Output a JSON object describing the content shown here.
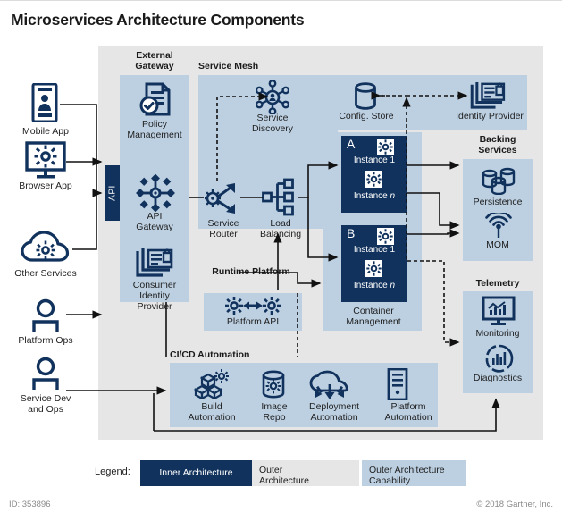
{
  "page": {
    "title": "Microservices Architecture Components",
    "id_text": "ID: 353896",
    "copyright": "© 2018 Gartner, Inc."
  },
  "colors": {
    "inner_architecture": "#11325c",
    "outer_architecture": "#e6e6e6",
    "outer_architecture_capability": "#bdd0e2",
    "icon_navy": "#11325c",
    "page_background": "#ffffff"
  },
  "actors": [
    {
      "id": "mobile-app",
      "label": "Mobile App",
      "icon": "smartphone-person-icon"
    },
    {
      "id": "browser-app",
      "label": "Browser App",
      "icon": "monitor-gear-icon"
    },
    {
      "id": "other-services",
      "label": "Other Services",
      "icon": "cloud-gear-icon"
    },
    {
      "id": "platform-ops",
      "label": "Platform Ops",
      "icon": "person-icon"
    },
    {
      "id": "service-dev-ops",
      "label": "Service Dev\nand Ops",
      "icon": "person-icon"
    }
  ],
  "api_bar": {
    "label": "API"
  },
  "groups": {
    "external_gateway": {
      "title": "External\nGateway",
      "items": [
        {
          "label": "Policy\nManagement",
          "icon": "policy-document-check-icon"
        },
        {
          "label": "API\nGateway",
          "icon": "api-gateway-hub-icon"
        },
        {
          "label": "Consumer\nIdentity\nProvider",
          "icon": "identity-lock-icon"
        }
      ]
    },
    "service_mesh": {
      "title": "Service Mesh",
      "items": [
        {
          "label": "Service\nDiscovery",
          "icon": "service-discovery-icon"
        },
        {
          "label": "Config. Store",
          "icon": "database-cylinder-icon"
        },
        {
          "label": "Identity Provider",
          "icon": "identity-lock-icon"
        },
        {
          "label": "Service\nRouter",
          "icon": "service-router-icon"
        },
        {
          "label": "Load\nBalancing",
          "icon": "load-balancer-icon"
        }
      ]
    },
    "runtime_platform": {
      "title": "Runtime\nPlatform",
      "items": [
        {
          "label": "Platform API",
          "icon": "platform-api-gears-icon"
        }
      ]
    },
    "container_management": {
      "title": "Container\nManagement",
      "services": [
        {
          "letter": "A",
          "instances": [
            {
              "name": "Instance 1",
              "icon": "gear-icon"
            },
            {
              "name": "Instance n",
              "icon": "gear-icon",
              "italic_suffix": "n"
            }
          ]
        },
        {
          "letter": "B",
          "instances": [
            {
              "name": "Instance 1",
              "icon": "gear-icon"
            },
            {
              "name": "Instance n",
              "icon": "gear-icon",
              "italic_suffix": "n"
            }
          ]
        }
      ]
    },
    "backing_services": {
      "title": "Backing\nServices",
      "items": [
        {
          "label": "Persistence",
          "icon": "database-stack-icon"
        },
        {
          "label": "MOM",
          "icon": "broadcast-antenna-icon"
        }
      ]
    },
    "telemetry": {
      "title": "Telemetry",
      "items": [
        {
          "label": "Monitoring",
          "icon": "monitor-chart-icon"
        },
        {
          "label": "Diagnostics",
          "icon": "diagnostics-gauge-icon"
        }
      ]
    },
    "cicd_automation": {
      "title": "CI/CD Automation",
      "items": [
        {
          "label": "Build\nAutomation",
          "icon": "build-blocks-gear-icon"
        },
        {
          "label": "Image\nRepo",
          "icon": "image-repo-cylinder-gear-icon"
        },
        {
          "label": "Deployment\nAutomation",
          "icon": "cloud-deploy-arrows-icon"
        },
        {
          "label": "Platform\nAutomation",
          "icon": "server-rack-icon"
        }
      ]
    }
  },
  "legend": {
    "label": "Legend:",
    "items": [
      {
        "key": "inner",
        "text": "Inner Architecture"
      },
      {
        "key": "outer",
        "text": "Outer\nArchitecture"
      },
      {
        "key": "outercap",
        "text": "Outer Architecture\nCapability"
      }
    ]
  }
}
